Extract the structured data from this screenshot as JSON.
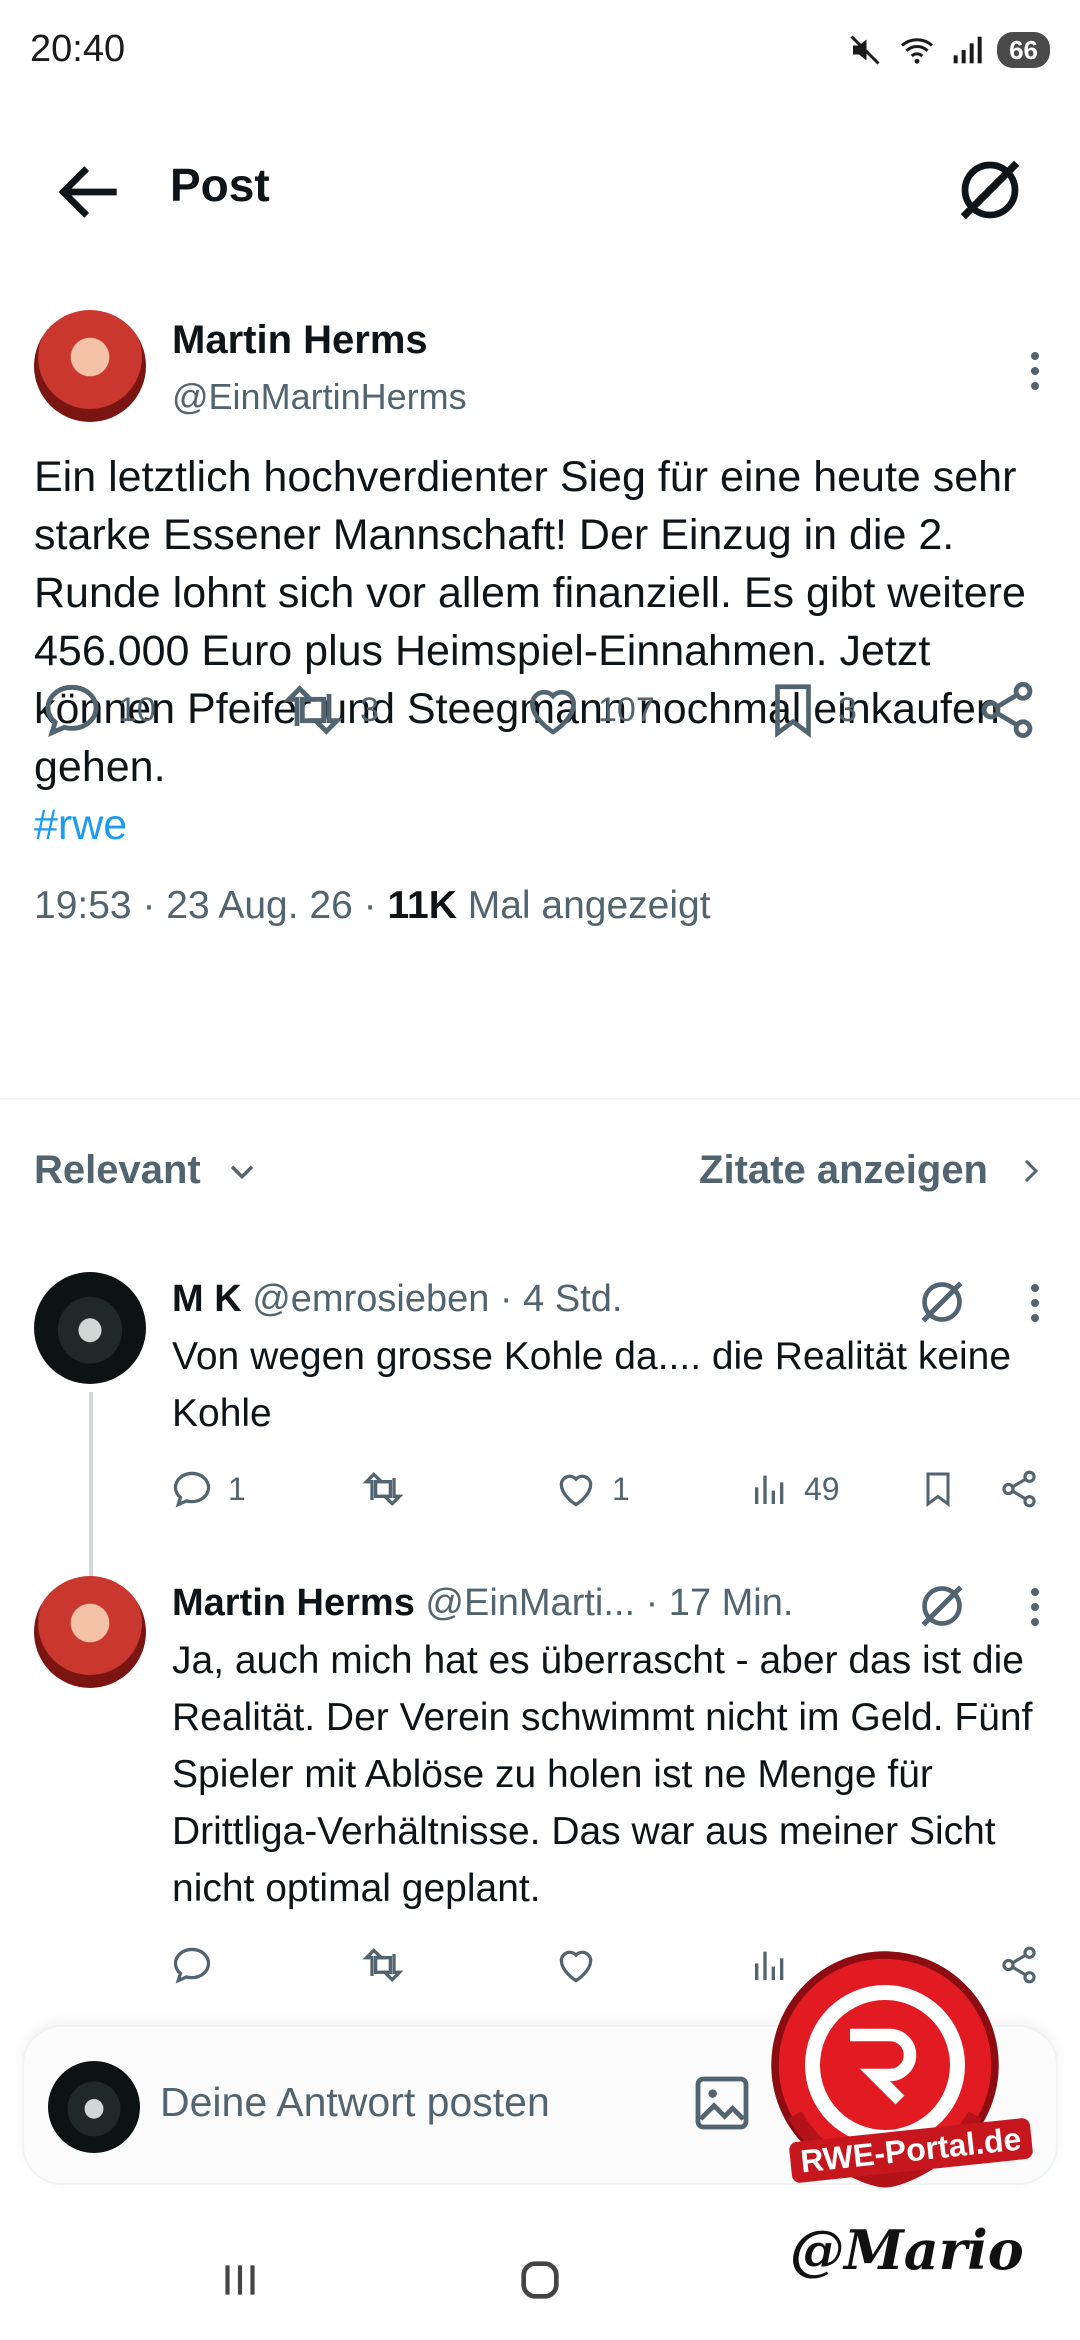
{
  "status_bar": {
    "time": "20:40",
    "battery": "66"
  },
  "header": {
    "title": "Post"
  },
  "post": {
    "author_name": "Martin Herms",
    "author_handle": "@EinMartinHerms",
    "text": "Ein letztlich hochverdienter Sieg für eine heute sehr starke Essener Mannschaft! Der Einzug in die 2. Runde lohnt sich vor allem finanziell. Es gibt weitere 456.000 Euro plus Heimspiel-Einnahmen. Jetzt können Pfeifer und Steegmann nochmal einkaufen gehen.",
    "hashtag": "#rwe",
    "time": "19:53",
    "date": "23 Aug. 26",
    "views": "11K",
    "views_label": "Mal angezeigt",
    "replies": "10",
    "reposts": "3",
    "likes": "107",
    "bookmarks": "3"
  },
  "sort": {
    "left_label": "Relevant",
    "right_label": "Zitate anzeigen"
  },
  "replies": [
    {
      "name": "M K",
      "handle": "@emrosieben",
      "time": "· 4 Std.",
      "text": "Von wegen grosse Kohle da.... die Realität keine Kohle",
      "replies": "1",
      "reposts": "",
      "likes": "1",
      "views": "49"
    },
    {
      "name": "Martin Herms",
      "handle": "@EinMarti...",
      "time": "· 17 Min.",
      "text": "Ja, auch mich hat es überrascht - aber das ist die Realität. Der Verein schwimmt nicht im Geld. Fünf Spieler mit Ablöse zu holen ist ne Menge für Drittliga-Verhältnisse. Das war aus meiner Sicht nicht optimal geplant.",
      "replies": "",
      "reposts": "",
      "likes": "",
      "views": ""
    }
  ],
  "composer": {
    "placeholder": "Deine Antwort posten"
  },
  "watermark": {
    "portal": "RWE-Portal.de",
    "signature": "@Mario"
  },
  "icons": {
    "back": "arrow-left-icon",
    "grok": "grok-icon",
    "reply": "reply-icon",
    "repost": "repost-icon",
    "like": "heart-icon",
    "bookmark": "bookmark-icon",
    "share": "share-icon",
    "views": "views-icon",
    "image": "image-icon"
  },
  "colors": {
    "link": "#1d9bf0",
    "secondary": "#536471",
    "primary_text": "#0f1419"
  }
}
